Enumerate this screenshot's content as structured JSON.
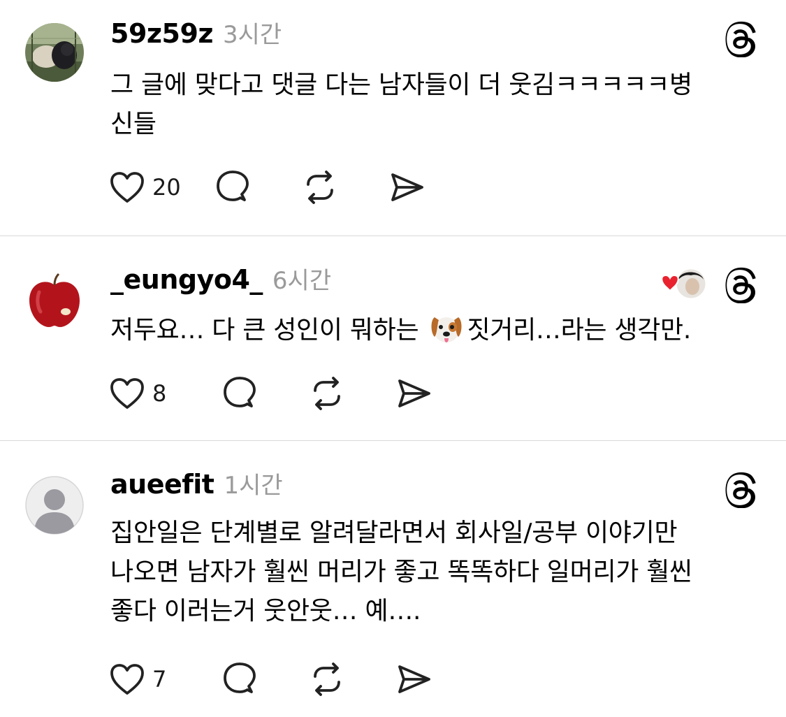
{
  "posts": [
    {
      "username": "59z59z",
      "time": "3시간",
      "lines": [
        "그 글에 맞다고 댓글 다는 남자들이 더 웃김ㅋㅋㅋㅋㅋ병",
        "신들"
      ],
      "likes": "20",
      "avatar_icon": "photo-avatar-icon",
      "has_liker": false
    },
    {
      "username": "_eungyo4_",
      "time": "6시간",
      "line_before_emoji": "저두요… 다 큰 성인이 뭐하는 ",
      "emoji_icon": "dog-face-icon",
      "line_after_emoji": "짓거리…라는 생각만.",
      "likes": "8",
      "avatar_icon": "apple-avatar-icon",
      "has_liker": true
    },
    {
      "username": "aueefit",
      "time": "1시간",
      "lines": [
        "집안일은 단계별로 알려달라면서 회사일/공부 이야기만",
        "나오면 남자가 훨씬 머리가 좋고 똑똑하다 일머리가 훨씬",
        "좋다 이러는거 웃안웃… 예…."
      ],
      "likes": "7",
      "avatar_icon": "default-person-avatar-icon",
      "has_liker": false
    }
  ],
  "icons": {
    "like": "heart-outline-icon",
    "reply": "speech-bubble-icon",
    "repost": "repost-arrows-icon",
    "share": "send-arrow-icon",
    "brand": "threads-logo-icon"
  },
  "colors": {
    "text": "#000000",
    "secondary": "#9a9a9a",
    "divider": "#d9d9d9",
    "like_red": "#e8232f"
  }
}
